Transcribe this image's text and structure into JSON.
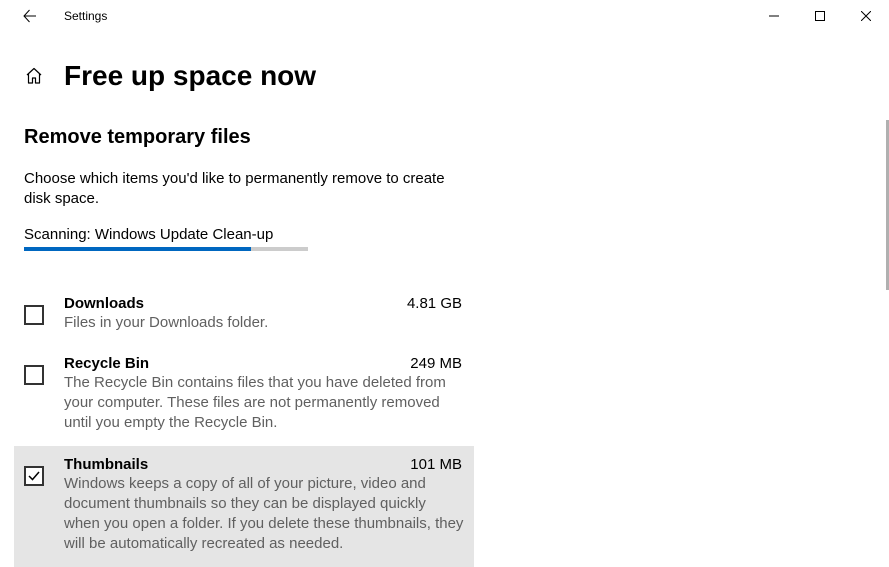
{
  "window": {
    "app_title": "Settings"
  },
  "page": {
    "title": "Free up space now",
    "section_title": "Remove temporary files",
    "description": "Choose which items you'd like to permanently remove to create disk space.",
    "scanning_label": "Scanning: Windows Update Clean-up",
    "progress_percent": 80
  },
  "items": [
    {
      "title": "Downloads",
      "size": "4.81 GB",
      "description": "Files in your Downloads folder.",
      "checked": false,
      "selected": false
    },
    {
      "title": "Recycle Bin",
      "size": "249 MB",
      "description": "The Recycle Bin contains files that you have deleted from your computer. These files are not permanently removed until you empty the Recycle Bin.",
      "checked": false,
      "selected": false
    },
    {
      "title": "Thumbnails",
      "size": "101 MB",
      "description": "Windows keeps a copy of all of your picture, video and document thumbnails so they can be displayed quickly when you open a folder. If you delete these thumbnails, they will be automatically recreated as needed.",
      "checked": true,
      "selected": true
    }
  ]
}
